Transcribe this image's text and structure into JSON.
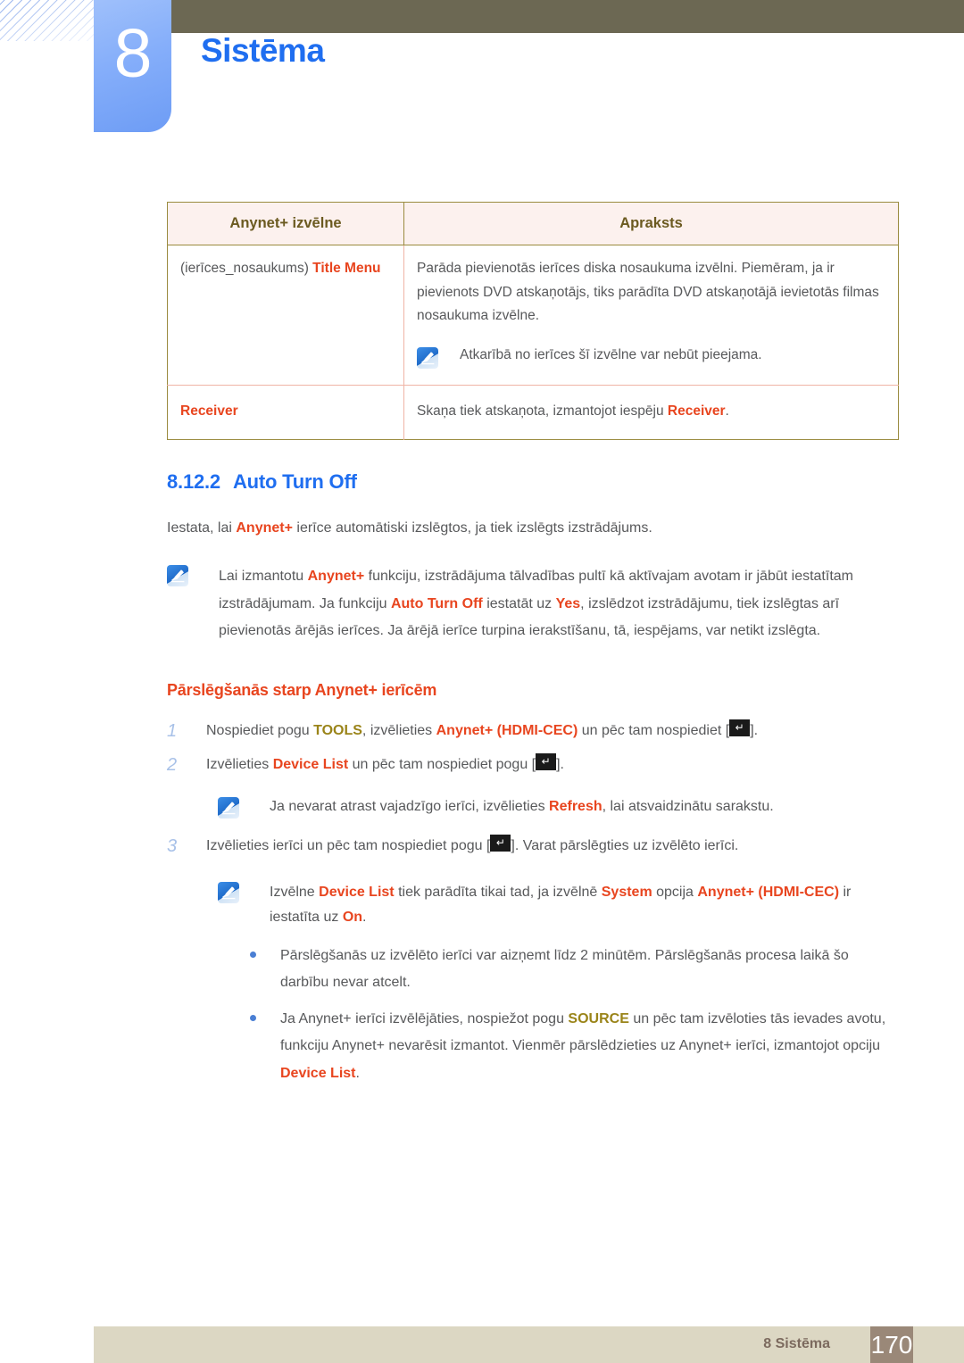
{
  "header": {
    "chapter_number": "8",
    "chapter_title": "Sistēma"
  },
  "table": {
    "columns": [
      "Anynet+ izvēlne",
      "Apraksts"
    ],
    "rows": [
      {
        "menu_prefix": "(ierīces_nosaukums) ",
        "menu_term": "Title Menu",
        "description_p1": "Parāda pievienotās ierīces diska nosaukuma izvēlni. Piemēram, ja ir pievienots DVD atskaņotājs, tiks parādīta DVD atskaņotājā ievietotās filmas nosaukuma izvēlne.",
        "note": "Atkarībā no ierīces šī izvēlne var nebūt pieejama."
      },
      {
        "menu_term": "Receiver",
        "desc_pre": "Skaņa tiek atskaņota, izmantojot iespēju ",
        "desc_term": "Receiver",
        "desc_post": "."
      }
    ]
  },
  "section": {
    "number": "8.12.2",
    "title": "Auto Turn Off",
    "intro_pre": "Iestata, lai ",
    "intro_term": "Anynet+",
    "intro_post": " ierīce automātiski izslēgtos, ja tiek izslēgts izstrādājums.",
    "note": {
      "s1": "Lai izmantotu ",
      "t1": "Anynet+",
      "s2": " funkciju, izstrādājuma tālvadības pultī kā aktīvajam avotam ir jābūt iestatītam izstrādājumam. Ja funkciju ",
      "t2": "Auto Turn Off",
      "s3": " iestatāt uz ",
      "t3": "Yes",
      "s4": ", izslēdzot izstrādājumu, tiek izslēgtas arī pievienotās ārējās ierīces. Ja ārējā ierīce turpina ierakstīšanu, tā, iespējams, var netikt izslēgta."
    }
  },
  "subsection": {
    "title": "Pārslēgšanās starp Anynet+ ierīcēm",
    "steps": [
      {
        "number": "1",
        "s1": "Nospiediet pogu ",
        "t1": "TOOLS",
        "t1_style": "y",
        "s2": ", izvēlieties ",
        "t2": "Anynet+ (HDMI-CEC)",
        "t2_style": "r",
        "s3": " un pēc tam nospiediet [",
        "s4": "]."
      },
      {
        "number": "2",
        "s1": "Izvēlieties ",
        "t1": "Device List",
        "t1_style": "r",
        "s2": " un pēc tam nospiediet pogu [",
        "s3": "]."
      },
      {
        "number": "3",
        "s1": "Izvēlieties ierīci un pēc tam nospiediet pogu [",
        "s2": "]. Varat pārslēgties uz izvēlēto ierīci."
      }
    ],
    "step2_note": {
      "s1": "Ja nevarat atrast vajadzīgo ierīci, izvēlieties ",
      "t1": "Refresh",
      "s2": ", lai atsvaidzinātu sarakstu."
    },
    "final_note": {
      "s1": "Izvēlne ",
      "t1": "Device List",
      "s2": " tiek parādīta tikai tad, ja izvēlnē ",
      "t2": "System",
      "s3": " opcija ",
      "t3": "Anynet+ (HDMI-CEC)",
      "s4": " ir iestatīta uz ",
      "t4": "On",
      "s5": "."
    },
    "bullets": [
      {
        "text": "Pārslēgšanās uz izvēlēto ierīci var aizņemt līdz 2 minūtēm. Pārslēgšanās procesa laikā šo darbību nevar atcelt."
      },
      {
        "s1": "Ja Anynet+ ierīci izvēlējāties, nospiežot pogu ",
        "t1": "SOURCE",
        "t1_style": "y",
        "s2": " un pēc tam izvēloties tās ievades avotu, funkciju Anynet+ nevarēsit izmantot. Vienmēr pārslēdzieties uz Anynet+ ierīci, izmantojot opciju ",
        "t2": "Device List",
        "t2_style": "r",
        "s3": "."
      }
    ]
  },
  "footer": {
    "label": "8 Sistēma",
    "page": "170"
  },
  "icons": {
    "note": "note-pen-icon",
    "enter_key": "enter-key-icon",
    "enter_glyph": "↵",
    "bullet": "bullet-dot-icon"
  },
  "colors": {
    "accent_blue": "#1f6ef0",
    "accent_red": "#e8451f",
    "accent_olive": "#9a8419",
    "header_band": "#6c6853",
    "footer_band": "#dcd7c3",
    "page_block": "#9a8878"
  }
}
